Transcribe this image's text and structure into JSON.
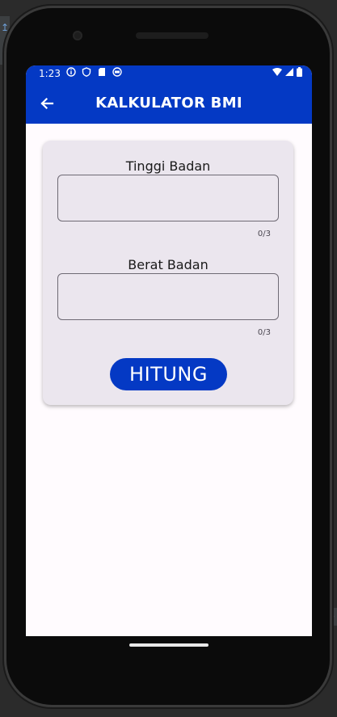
{
  "status_bar": {
    "time": "1:23",
    "left_icons": [
      "info-icon",
      "shield-icon",
      "sd-card-icon",
      "sync-icon"
    ],
    "right_icons": [
      "wifi-icon",
      "cell-signal-icon",
      "battery-icon"
    ]
  },
  "app_bar": {
    "title": "KALKULATOR BMI",
    "back_icon": "arrow-left-icon"
  },
  "form": {
    "height_label": "Tinggi Badan",
    "height_value": "",
    "height_counter": "0/3",
    "weight_label": "Berat Badan",
    "weight_value": "",
    "weight_counter": "0/3",
    "submit_label": "HITUNG"
  },
  "colors": {
    "primary": "#0439c4",
    "card_background": "#ebe6ee",
    "screen_background": "#fffbfe"
  }
}
